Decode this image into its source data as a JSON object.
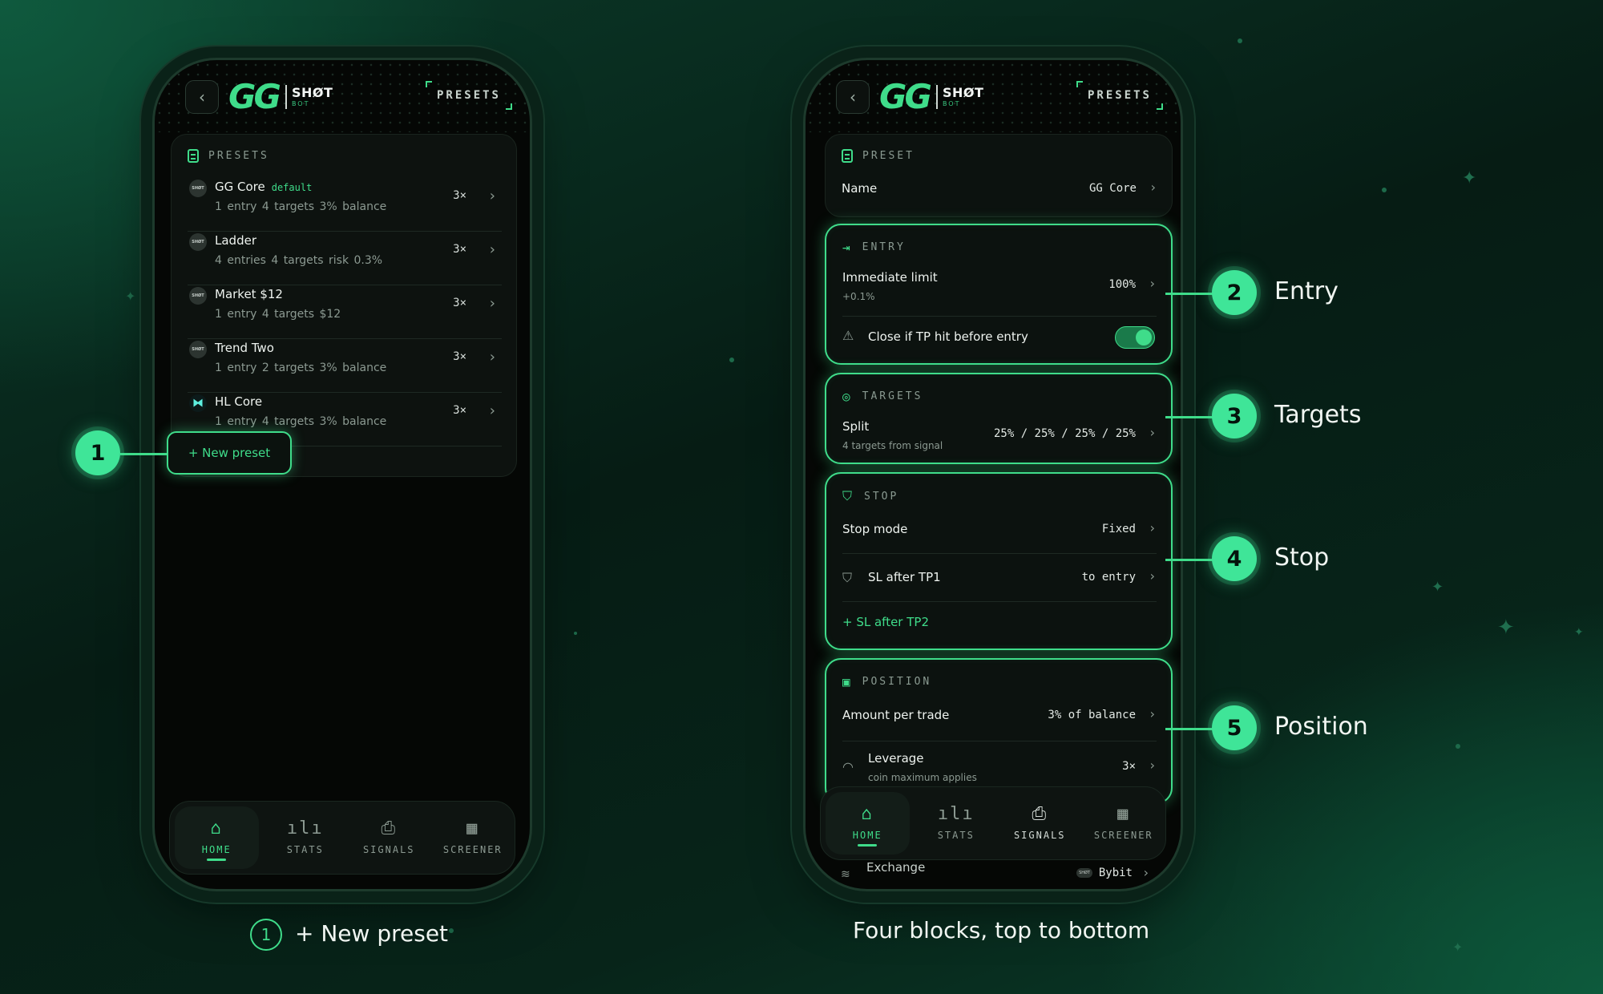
{
  "left_phone": {
    "header": {
      "back_glyph": "‹",
      "logo_main": "GG",
      "logo_shot": "SHØT",
      "logo_bot": "BOT",
      "title": "PRESETS"
    },
    "section_title": "PRESETS",
    "presets": [
      {
        "name": "GG Core",
        "tag": "default",
        "meta": "1 entry  4 targets  3% balance",
        "leverage": "3×",
        "avatar": "SHØT"
      },
      {
        "name": "Ladder",
        "tag": "",
        "meta": "4 entries  4 targets  risk 0.3%",
        "leverage": "3×",
        "avatar": "SHØT"
      },
      {
        "name": "Market $12",
        "tag": "",
        "meta": "1 entry  4 targets  $12",
        "leverage": "3×",
        "avatar": "SHØT"
      },
      {
        "name": "Trend Two",
        "tag": "",
        "meta": "1 entry  2 targets  3% balance",
        "leverage": "3×",
        "avatar": "SHØT"
      },
      {
        "name": "HL Core",
        "tag": "",
        "meta": "1 entry  4 targets  3% balance",
        "leverage": "3×",
        "avatar": "⧓"
      }
    ],
    "new_preset_label": "+ New preset",
    "nav": [
      {
        "label": "HOME",
        "icon": "⌂"
      },
      {
        "label": "STATS",
        "icon": "ılı"
      },
      {
        "label": "SIGNALS",
        "icon": "⎙"
      },
      {
        "label": "SCREENER",
        "icon": "▦"
      }
    ]
  },
  "right_phone": {
    "header": {
      "back_glyph": "‹",
      "logo_main": "GG",
      "logo_shot": "SHØT",
      "logo_bot": "BOT",
      "title": "PRESETS"
    },
    "preset": {
      "title": "PRESET",
      "name_label": "Name",
      "name_value": "GG Core"
    },
    "entry": {
      "title": "ENTRY",
      "type_label": "Immediate limit",
      "type_sub": "+0.1%",
      "type_value": "100%",
      "close_label": "Close if TP hit before entry",
      "close_enabled": true
    },
    "targets": {
      "title": "TARGETS",
      "split_label": "Split",
      "split_sub": "4 targets from signal",
      "split_value": "25% / 25% / 25% / 25%"
    },
    "stop": {
      "title": "STOP",
      "mode_label": "Stop mode",
      "mode_value": "Fixed",
      "sl_label": "SL after TP1",
      "sl_value": "to entry",
      "add_label": "+ SL after TP2"
    },
    "position": {
      "title": "POSITION",
      "amount_label": "Amount per trade",
      "amount_value": "3% of balance",
      "lev_label": "Leverage",
      "lev_sub": "coin maximum applies",
      "lev_value": "3×"
    },
    "exchange": {
      "label": "Exchange",
      "value": "Bybit",
      "avatar": "SHØT"
    },
    "nav": [
      {
        "label": "HOME",
        "icon": "⌂"
      },
      {
        "label": "STATS",
        "icon": "ılı"
      },
      {
        "label": "SIGNALS",
        "icon": "⎙"
      },
      {
        "label": "SCREENER",
        "icon": "▦"
      }
    ]
  },
  "callouts": [
    {
      "number": "1",
      "label": ""
    },
    {
      "number": "2",
      "label": "Entry"
    },
    {
      "number": "3",
      "label": "Targets"
    },
    {
      "number": "4",
      "label": "Stop"
    },
    {
      "number": "5",
      "label": "Position"
    }
  ],
  "captions": {
    "left_number": "1",
    "left_text": "+ New preset",
    "right_text": "Four blocks, top to bottom"
  },
  "colors": {
    "accent": "#3fdc8a",
    "background": "#072419",
    "phone": "#050705"
  }
}
